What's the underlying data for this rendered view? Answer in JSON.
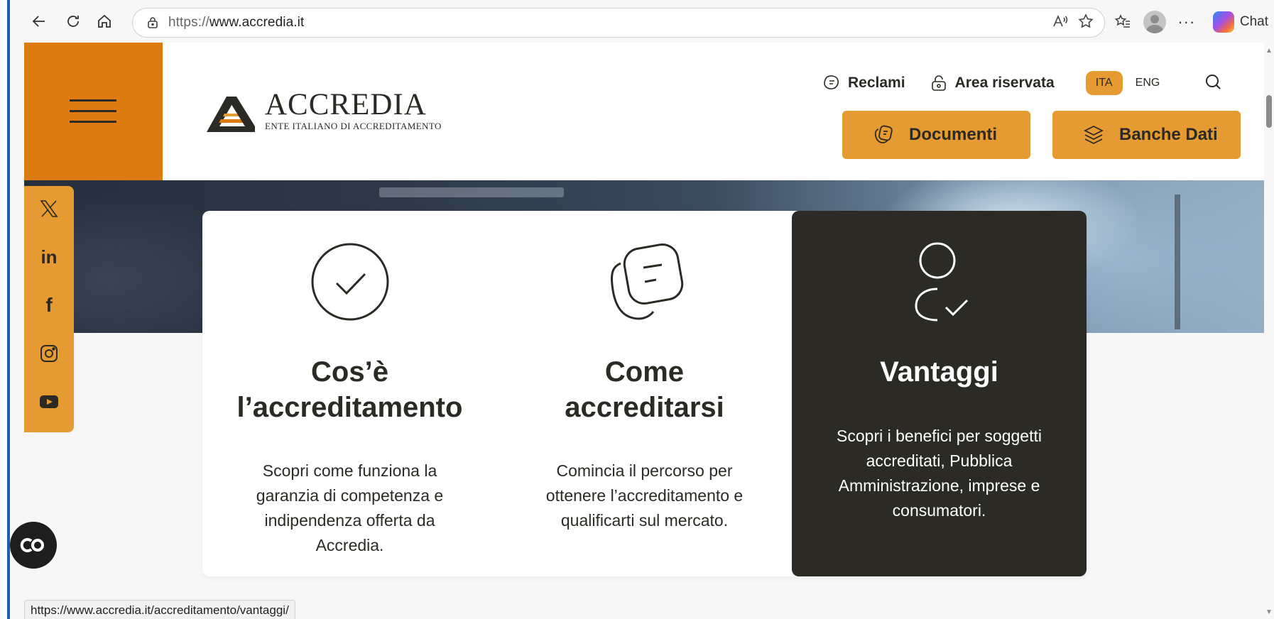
{
  "browser": {
    "url_protocol": "https://",
    "url_host": "www.accredia.it",
    "chat_label": "Chat",
    "status_url": "https://www.accredia.it/accreditamento/vantaggi/"
  },
  "header": {
    "logo_word": "ACCREDIA",
    "logo_subtitle": "ENTE ITALIANO DI ACCREDITAMENTO",
    "reclami": "Reclami",
    "area_riservata": "Area riservata",
    "lang_active": "ITA",
    "lang_other": "ENG",
    "documenti": "Documenti",
    "banche_dati": "Banche Dati"
  },
  "social": [
    "x-icon",
    "linkedin-icon",
    "facebook-icon",
    "instagram-icon",
    "youtube-icon"
  ],
  "cards": [
    {
      "title_line1": "Cos’è",
      "title_line2": "l’accreditamento",
      "desc_line1": "Scopri come funziona la",
      "desc_line2": "garanzia di competenza e",
      "desc_line3": "indipendenza offerta da",
      "desc_line4": "Accredia."
    },
    {
      "title_line1": "Come",
      "title_line2": "accreditarsi",
      "desc_line1": "Comincia il percorso per",
      "desc_line2": "ottenere l’accreditamento e",
      "desc_line3": "qualificarti sul mercato."
    },
    {
      "title": "Vantaggi",
      "desc_line1": "Scopri i benefici per soggetti",
      "desc_line2": "accreditati, Pubblica",
      "desc_line3": "Amministrazione, imprese e",
      "desc_line4": "consumatori."
    }
  ],
  "colors": {
    "orange_dark": "#dd7a10",
    "orange": "#e59a32",
    "ink": "#2b2a24",
    "window_edge": "#1a5fa8"
  }
}
